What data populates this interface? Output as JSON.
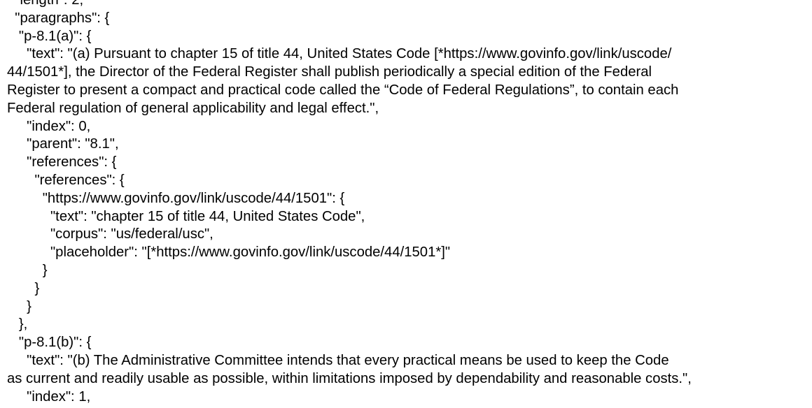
{
  "lines": [
    "  \"length\": 2,",
    "  \"paragraphs\": {",
    "   \"p-8.1(a)\": {",
    "     \"text\": \"(a) Pursuant to chapter 15 of title 44, United States Code [*https://www.govinfo.gov/link/uscode/",
    "44/1501*], the Director of the Federal Register shall publish periodically a special edition of the Federal",
    "Register to present a compact and practical code called the “Code of Federal Regulations”, to contain each",
    "Federal regulation of general applicability and legal effect.\",",
    "     \"index\": 0,",
    "     \"parent\": \"8.1\",",
    "     \"references\": {",
    "       \"references\": {",
    "         \"https://www.govinfo.gov/link/uscode/44/1501\": {",
    "           \"text\": \"chapter 15 of title 44, United States Code\",",
    "           \"corpus\": \"us/federal/usc\",",
    "           \"placeholder\": \"[*https://www.govinfo.gov/link/uscode/44/1501*]\"",
    "         }",
    "       }",
    "     }",
    "   },",
    "   \"p-8.1(b)\": {",
    "     \"text\": \"(b) The Administrative Committee intends that every practical means be used to keep the Code",
    "as current and readily usable as possible, within limitations imposed by dependability and reasonable costs.\",",
    "     \"index\": 1,"
  ]
}
